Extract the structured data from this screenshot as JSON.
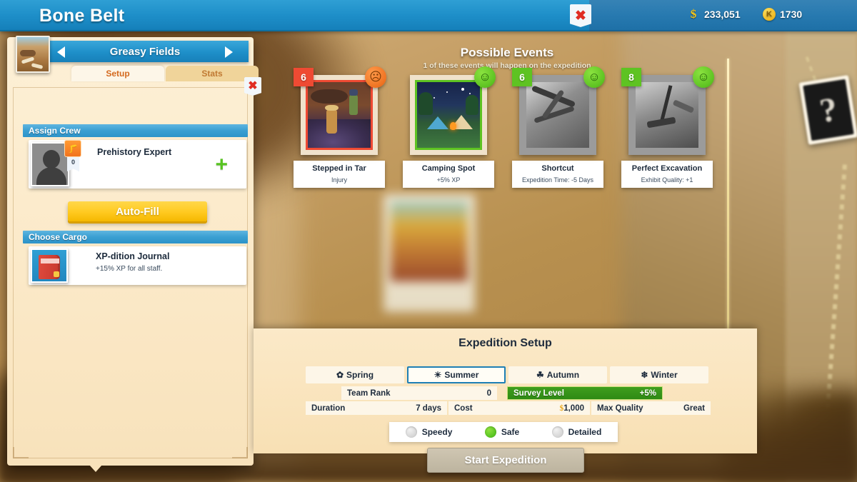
{
  "topbar": {
    "title": "Bone Belt",
    "close_icon": "close-icon",
    "currencies": [
      {
        "icon": "money-icon",
        "value": "233,051"
      },
      {
        "icon": "ticket-coin-icon",
        "value": "1730"
      }
    ]
  },
  "left_panel": {
    "location": {
      "name": "Greasy Fields",
      "prev_icon": "chevron-left-icon",
      "next_icon": "chevron-right-icon",
      "thumb_icon": "location-thumbnail-icon",
      "close_icon": "close-icon"
    },
    "tabs": [
      {
        "label": "Setup",
        "active": true
      },
      {
        "label": "Stats",
        "active": false
      }
    ],
    "assign_crew": {
      "header": "Assign Crew",
      "slot": {
        "role": "Prehistory Expert",
        "level": "0",
        "badge_icon": "prehistory-badge-icon",
        "add_icon": "plus-icon"
      },
      "auto_fill_label": "Auto-Fill"
    },
    "choose_cargo": {
      "header": "Choose Cargo",
      "item": {
        "name": "XP-dition Journal",
        "description": "+15% XP for all staff.",
        "icon": "journal-icon"
      }
    }
  },
  "events": {
    "title": "Possible Events",
    "subtitle": "1 of these events will happen on the expedition",
    "cards": [
      {
        "badge": "6",
        "badge_tone": "red",
        "face_icon": "sad-face-icon",
        "face_tone": "sad",
        "frame_tone": "red",
        "name": "Stepped in Tar",
        "effect": "Injury"
      },
      {
        "badge": "",
        "badge_tone": "none",
        "face_icon": "happy-face-icon",
        "face_tone": "happy",
        "frame_tone": "green",
        "name": "Camping Spot",
        "effect": "+5% XP"
      },
      {
        "badge": "6",
        "badge_tone": "green",
        "face_icon": "happy-face-icon",
        "face_tone": "happy",
        "frame_tone": "gray",
        "name": "Shortcut",
        "effect": "Expedition Time: -5 Days"
      },
      {
        "badge": "8",
        "badge_tone": "green",
        "face_icon": "happy-face-icon",
        "face_tone": "happy",
        "frame_tone": "gray",
        "name": "Perfect Excavation",
        "effect": "Exhibit Quality: +1"
      }
    ]
  },
  "setup": {
    "title": "Expedition Setup",
    "seasons": [
      {
        "label": "Spring",
        "icon": "flower-icon",
        "glyph": "✿",
        "selected": false
      },
      {
        "label": "Summer",
        "icon": "sun-icon",
        "glyph": "☀",
        "selected": true
      },
      {
        "label": "Autumn",
        "icon": "leaf-icon",
        "glyph": "☘",
        "selected": false
      },
      {
        "label": "Winter",
        "icon": "snowflake-icon",
        "glyph": "❄",
        "selected": false
      }
    ],
    "team_rank": {
      "label": "Team Rank",
      "value": "0"
    },
    "survey_level": {
      "label": "Survey Level",
      "value": "+5%"
    },
    "stats": [
      {
        "label": "Duration",
        "value": "7 days"
      },
      {
        "label": "Cost",
        "value": "1,000",
        "currency_icon": "money-icon"
      },
      {
        "label": "Max Quality",
        "value": "Great"
      }
    ],
    "speed_options": [
      {
        "label": "Speedy",
        "selected": false
      },
      {
        "label": "Safe",
        "selected": true
      },
      {
        "label": "Detailed",
        "selected": false
      }
    ],
    "start_button": "Start Expedition"
  },
  "map": {
    "marker_icon": "question-mark-marker-icon",
    "marker_glyph": "?"
  },
  "colors": {
    "accent_blue": "#1e8fc9",
    "panel_cream": "#fbe9c8",
    "danger_red": "#ef4a33",
    "success_green": "#5ec322",
    "gold": "#ffc91f"
  }
}
